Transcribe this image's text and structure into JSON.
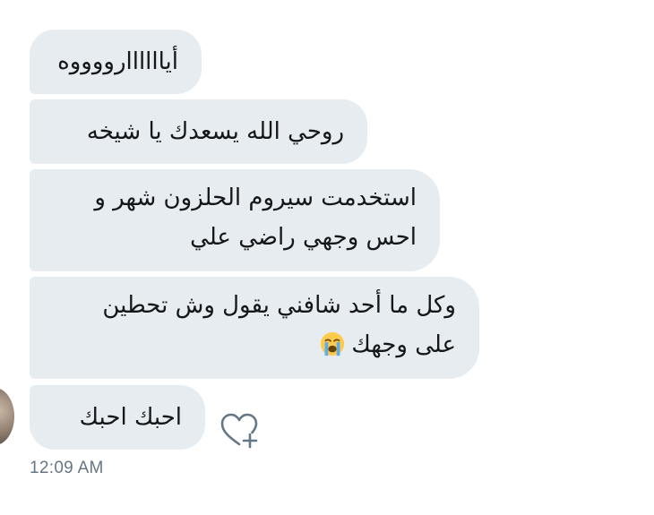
{
  "messages": [
    {
      "lines": [
        "أياااااارووووه"
      ]
    },
    {
      "lines": [
        "روحي الله يسعدك يا شيخه"
      ]
    },
    {
      "lines": [
        "استخدمت سيروم الحلزون شهر و",
        "احس وجهي راضي علي"
      ]
    },
    {
      "lines": [
        "وكل ما أحد شافني يقول وش تحطين",
        "على وجهك"
      ],
      "emoji": "crying-face"
    },
    {
      "lines": [
        "احبك احبك"
      ]
    }
  ],
  "timestamp": "12:09 AM",
  "colors": {
    "bubble": "#e6ecf0",
    "text": "#14171a",
    "timestamp": "#657786",
    "react_icon": "#657786"
  }
}
